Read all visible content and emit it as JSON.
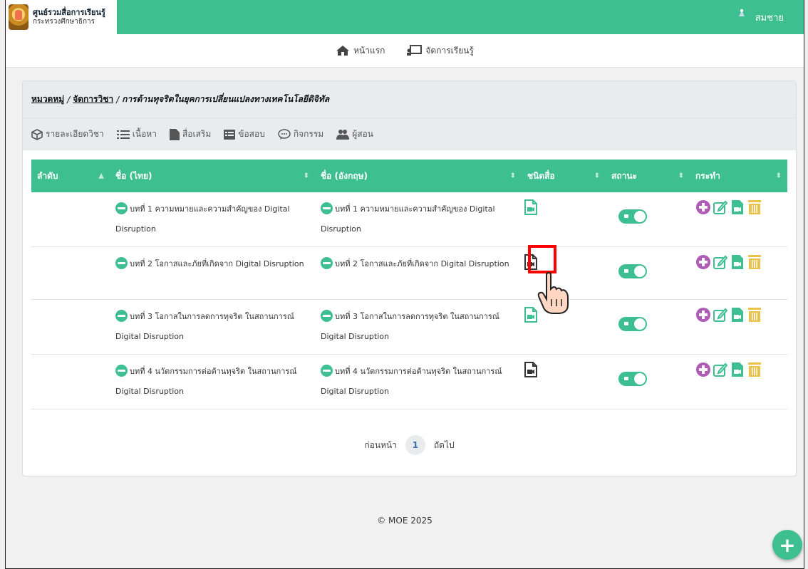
{
  "brand": {
    "title": "ศูนย์รวมสื่อการเรียนรู้",
    "subtitle": "กระทรวงศึกษาธิการ"
  },
  "user": {
    "name": "สมชาย"
  },
  "nav": [
    {
      "label": "หน้าแรก",
      "icon": "home-icon"
    },
    {
      "label": "จัดการเรียนรู้",
      "icon": "classroom-icon"
    }
  ],
  "breadcrumb": {
    "root": "หมวดหมู่",
    "section": "จัดการวิชา",
    "current": "การต้านทุจริตในยุคการเปลี่ยนแปลงทางเทคโนโลยีดิจิทัล",
    "sep": "/"
  },
  "tabs": [
    {
      "label": "รายละเอียดวิชา",
      "icon": "cube-icon"
    },
    {
      "label": "เนื้อหา",
      "icon": "list-icon"
    },
    {
      "label": "สื่อเสริม",
      "icon": "file-icon"
    },
    {
      "label": "ข้อสอบ",
      "icon": "table-icon"
    },
    {
      "label": "กิจกรรม",
      "icon": "chat-icon"
    },
    {
      "label": "ผู้สอน",
      "icon": "users-icon"
    }
  ],
  "table": {
    "headers": [
      "ลำดับ",
      "ชื่อ (ไทย)",
      "ชื่อ (อังกฤษ)",
      "ชนิดสื่อ",
      "สถานะ",
      "กระทำ"
    ],
    "rows": [
      {
        "name_th_1": "บทที่ 1 ความหมายและความสำคัญของ Digital",
        "name_th_2": "Disruption",
        "name_en_1": "บทที่ 1 ความหมายและความสำคัญของ Digital",
        "name_en_2": "Disruption",
        "media": "video-file-icon",
        "status": "on"
      },
      {
        "name_th_1": "บทที่ 2 โอกาสและภัยที่เกิดจาก Digital Disruption",
        "name_th_2": "",
        "name_en_1": "บทที่ 2 โอกาสและภัยที่เกิดจาก Digital Disruption",
        "name_en_2": "",
        "media": "video-file-icon",
        "status": "on"
      },
      {
        "name_th_1": "บทที่ 3 โอกาสในการลดการทุจริต ในสถานการณ์",
        "name_th_2": "Digital Disruption",
        "name_en_1": "บทที่ 3 โอกาสในการลดการทุจริต ในสถานการณ์",
        "name_en_2": "Digital Disruption",
        "media": "video-file-icon",
        "status": "on"
      },
      {
        "name_th_1": "บทที่ 4 นวัตกรรมการต่อต้านทุจริต ในสถานการณ์",
        "name_th_2": "Digital Disruption",
        "name_en_1": "บทที่ 4 นวัตกรรมการต่อต้านทุจริต ในสถานการณ์",
        "name_en_2": "Digital Disruption",
        "media": "video-file-icon",
        "status": "on"
      }
    ]
  },
  "pager": {
    "prev": "ก่อนหน้า",
    "page": "1",
    "next": "ถัดไป"
  },
  "footer": "© MOE 2025",
  "fab": "+",
  "colors": {
    "primary": "#3dbf91",
    "add": "#b05bb8",
    "delete": "#e9c24a",
    "highlight": "#ff0000"
  }
}
